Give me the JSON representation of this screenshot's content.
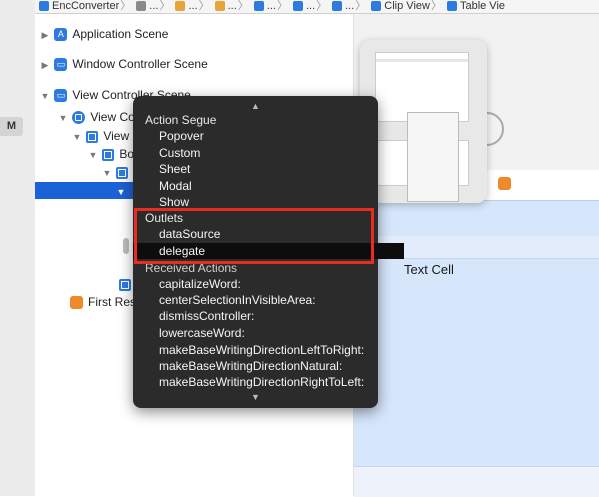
{
  "jumpbar": {
    "items": [
      "EncConverter",
      "...",
      "...",
      "...",
      "...",
      "...",
      "...",
      "Clip View",
      "Table Vie"
    ]
  },
  "gutter": {
    "badge": "M"
  },
  "outline": {
    "rows": {
      "application_scene": "Application Scene",
      "window_controller_scene": "Window Controller Scene",
      "view_controller_scene": "View Controller Scene",
      "view_controller": "View Co",
      "view": "View",
      "bordered": "Bo",
      "first_responder": "First Res"
    }
  },
  "canvas": {
    "text_cell": "Text Cell"
  },
  "hud": {
    "sections": {
      "action_segue": "Action Segue",
      "outlets": "Outlets",
      "received_actions": "Received Actions"
    },
    "segues": [
      "Popover",
      "Custom",
      "Sheet",
      "Modal",
      "Show"
    ],
    "outlets": [
      "dataSource",
      "delegate"
    ],
    "selected_outlet": "delegate",
    "actions": [
      "capitalizeWord:",
      "centerSelectionInVisibleArea:",
      "dismissController:",
      "lowercaseWord:",
      "makeBaseWritingDirectionLeftToRight:",
      "makeBaseWritingDirectionNatural:",
      "makeBaseWritingDirectionRightToLeft:"
    ],
    "scroll_up": "▲",
    "scroll_down": "▼"
  },
  "colors": {
    "highlight": "#ea2b1f",
    "selection": "#1b62d6",
    "hud_bg": "#2b2b2b",
    "accent": "#2d7be0"
  }
}
